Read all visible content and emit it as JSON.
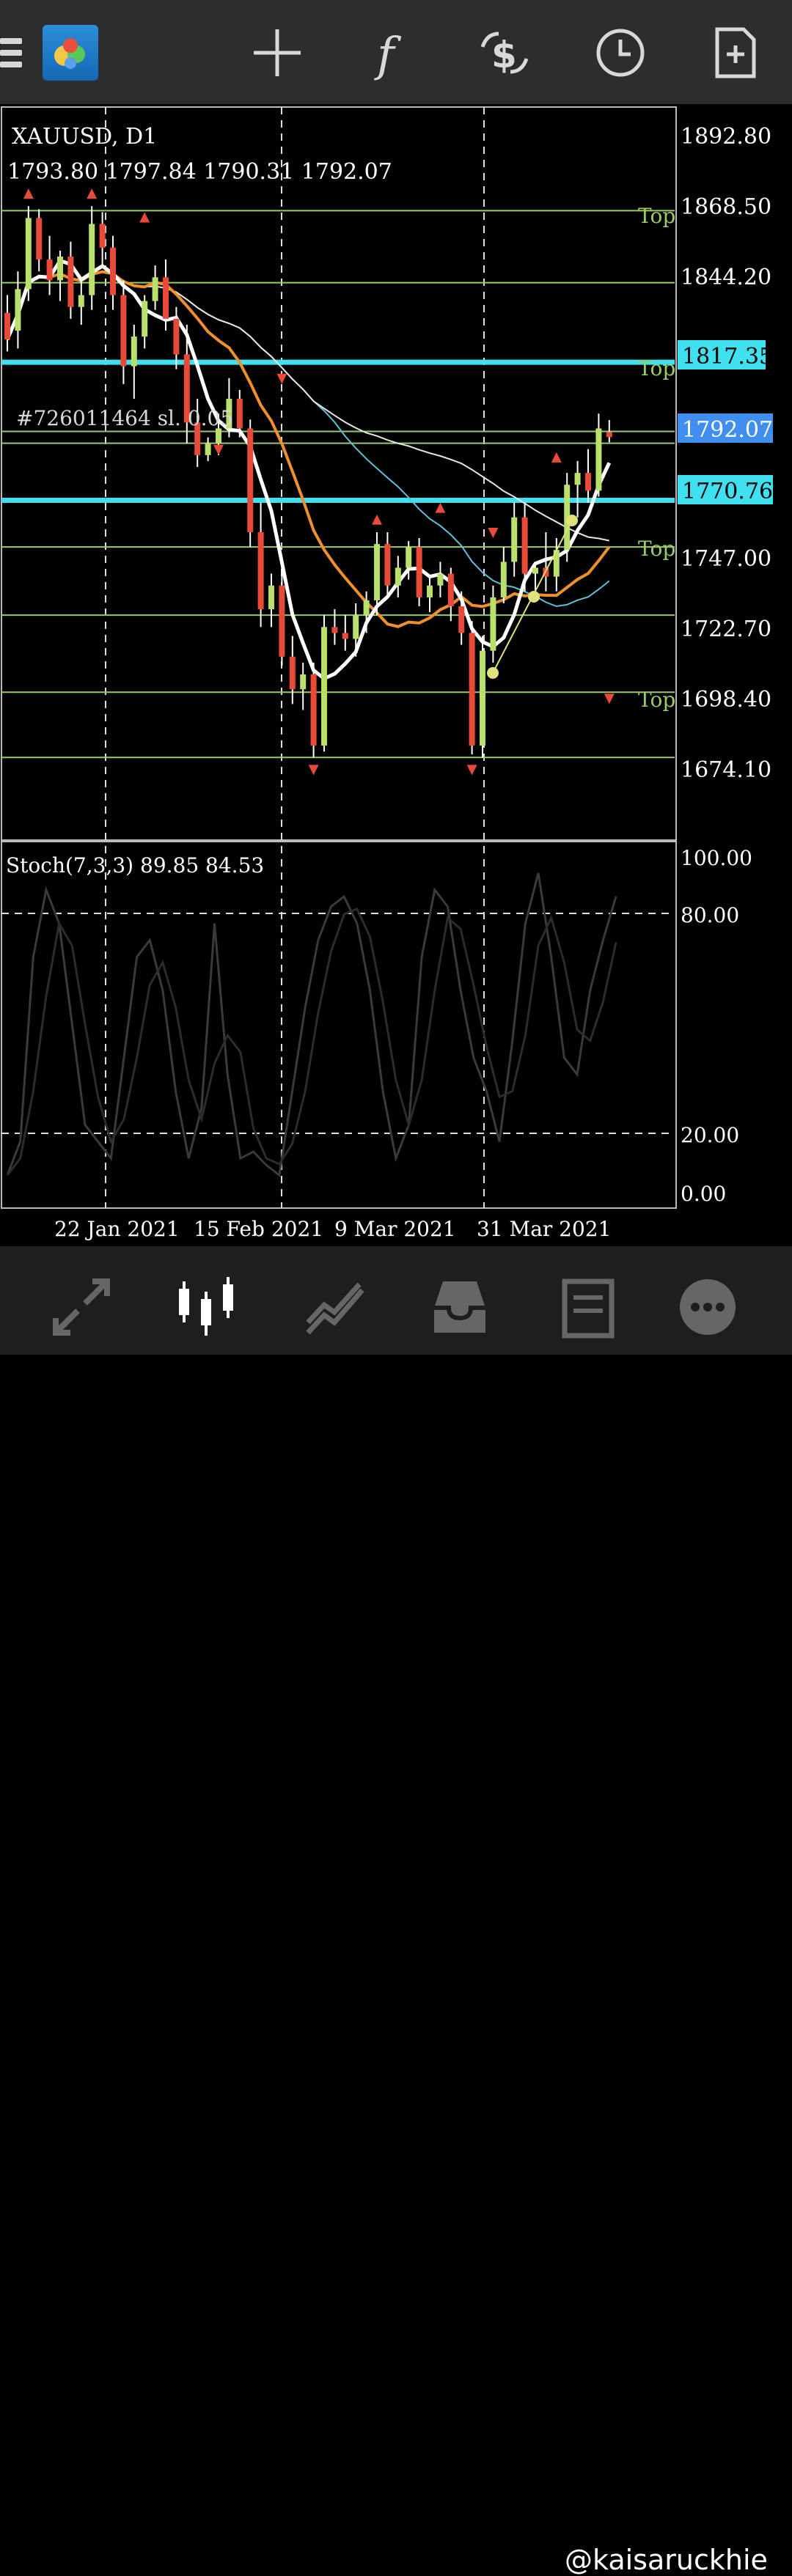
{
  "toolbar": {
    "icons": [
      "menu-icon",
      "app-logo",
      "crosshair-icon",
      "function-icon",
      "trade-icon",
      "clock-icon",
      "new-document-icon"
    ]
  },
  "chart": {
    "symbol_label": "XAUUSD, D1",
    "ohlc_label": "1793.80 1797.84 1790.31 1792.07",
    "order_label": "#726011464  sl. 0.05",
    "price_labels": [
      "1892.80",
      "1868.50",
      "1844.20",
      "1722.70",
      "1698.40",
      "1674.10",
      "1747.00"
    ],
    "level_tags": {
      "upper": "1817.35",
      "current": "1792.07",
      "lower": "1770.76"
    },
    "top_labels": [
      "Top",
      "Top",
      "Top",
      "Top"
    ],
    "time_labels": [
      "22 Jan 2021",
      "15 Feb 2021",
      "9 Mar 2021",
      "31 Mar 2021"
    ],
    "colors": {
      "up": "#b8e06a",
      "down": "#e84a3a",
      "ma_white": "#ffffff",
      "ma_orange": "#f0902a",
      "ma_teal": "#5fc0d8",
      "level_cyan": "#3fe0f0",
      "level_green": "#9acc66",
      "current_tag": "#3f8ef0"
    }
  },
  "stoch": {
    "label": "Stoch(7,3,3) 89.85 84.53",
    "levels": [
      "100.00",
      "80.00",
      "20.00",
      "0.00"
    ]
  },
  "bottom_nav": {
    "icons": [
      "quotes-icon",
      "chart-icon",
      "trade-icon",
      "history-icon",
      "news-icon",
      "messages-icon"
    ]
  },
  "watermark": "@kaisaruckhie",
  "chart_data": {
    "type": "candlestick",
    "symbol": "XAUUSD",
    "timeframe": "D1",
    "ylim": [
      1665,
      1900
    ],
    "last_close": 1792.07,
    "horizontal_levels": [
      1868.5,
      1844.2,
      1817.35,
      1794.0,
      1790.0,
      1770.76,
      1755.0,
      1732.0,
      1706.0,
      1684.0
    ],
    "candles": [
      [
        1834,
        1840,
        1821,
        1825
      ],
      [
        1828,
        1848,
        1822,
        1842
      ],
      [
        1842,
        1870,
        1838,
        1866
      ],
      [
        1866,
        1869,
        1848,
        1852
      ],
      [
        1852,
        1860,
        1840,
        1845
      ],
      [
        1845,
        1855,
        1838,
        1853
      ],
      [
        1853,
        1858,
        1832,
        1836
      ],
      [
        1836,
        1846,
        1830,
        1840
      ],
      [
        1840,
        1870,
        1835,
        1864
      ],
      [
        1864,
        1868,
        1850,
        1856
      ],
      [
        1856,
        1860,
        1835,
        1840
      ],
      [
        1840,
        1845,
        1810,
        1816
      ],
      [
        1816,
        1830,
        1805,
        1826
      ],
      [
        1826,
        1840,
        1822,
        1838
      ],
      [
        1838,
        1850,
        1835,
        1846
      ],
      [
        1846,
        1852,
        1828,
        1832
      ],
      [
        1832,
        1836,
        1815,
        1820
      ],
      [
        1820,
        1830,
        1790,
        1797
      ],
      [
        1797,
        1805,
        1782,
        1786
      ],
      [
        1786,
        1792,
        1784,
        1790
      ],
      [
        1790,
        1800,
        1786,
        1795
      ],
      [
        1795,
        1812,
        1792,
        1805
      ],
      [
        1805,
        1808,
        1792,
        1795
      ],
      [
        1795,
        1798,
        1755,
        1760
      ],
      [
        1760,
        1770,
        1728,
        1734
      ],
      [
        1734,
        1746,
        1728,
        1742
      ],
      [
        1742,
        1748,
        1715,
        1718
      ],
      [
        1718,
        1725,
        1702,
        1707
      ],
      [
        1707,
        1716,
        1700,
        1712
      ],
      [
        1712,
        1716,
        1684,
        1688
      ],
      [
        1688,
        1732,
        1686,
        1728
      ],
      [
        1728,
        1734,
        1722,
        1726
      ],
      [
        1726,
        1732,
        1720,
        1724
      ],
      [
        1724,
        1736,
        1718,
        1732
      ],
      [
        1732,
        1740,
        1726,
        1737
      ],
      [
        1737,
        1760,
        1732,
        1756
      ],
      [
        1756,
        1760,
        1738,
        1742
      ],
      [
        1742,
        1752,
        1738,
        1748
      ],
      [
        1748,
        1757,
        1744,
        1755
      ],
      [
        1755,
        1758,
        1735,
        1738
      ],
      [
        1738,
        1745,
        1733,
        1742
      ],
      [
        1742,
        1750,
        1738,
        1746
      ],
      [
        1746,
        1748,
        1730,
        1735
      ],
      [
        1735,
        1740,
        1722,
        1726
      ],
      [
        1726,
        1730,
        1685,
        1688
      ],
      [
        1688,
        1725,
        1684,
        1720
      ],
      [
        1720,
        1742,
        1716,
        1738
      ],
      [
        1738,
        1755,
        1736,
        1750
      ],
      [
        1750,
        1770,
        1745,
        1765
      ],
      [
        1765,
        1770,
        1740,
        1746
      ],
      [
        1746,
        1750,
        1738,
        1748
      ],
      [
        1748,
        1760,
        1740,
        1745
      ],
      [
        1745,
        1758,
        1740,
        1754
      ],
      [
        1754,
        1780,
        1750,
        1776
      ],
      [
        1776,
        1784,
        1765,
        1780
      ],
      [
        1780,
        1788,
        1770,
        1774
      ],
      [
        1774,
        1800,
        1772,
        1795
      ],
      [
        1793.8,
        1797.84,
        1790.31,
        1792.07
      ]
    ]
  }
}
